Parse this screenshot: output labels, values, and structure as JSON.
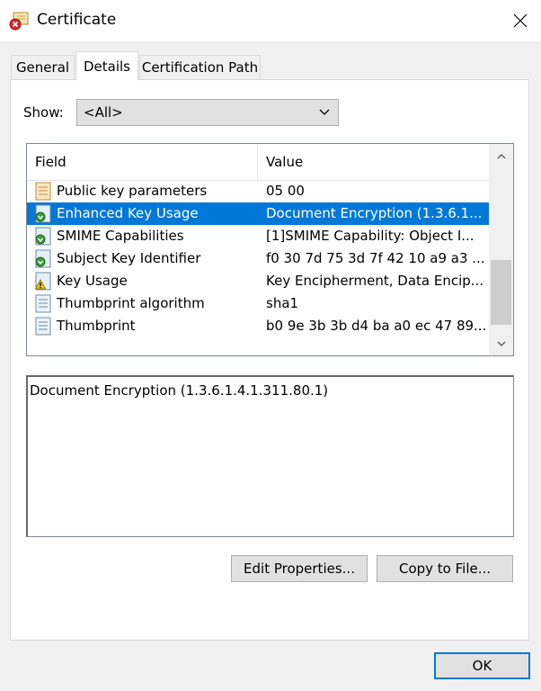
{
  "window": {
    "title": "Certificate",
    "title_icon": "certificate-error-icon",
    "close_icon": "close-icon"
  },
  "tabs": [
    {
      "label": "General"
    },
    {
      "label": "Details",
      "active": true
    },
    {
      "label": "Certification Path"
    }
  ],
  "show": {
    "label": "Show:",
    "selected": "<All>"
  },
  "list": {
    "headers": {
      "field": "Field",
      "value": "Value"
    },
    "rows": [
      {
        "field": "Public key parameters",
        "value": "05 00",
        "icon": "document-icon"
      },
      {
        "field": "Enhanced Key Usage",
        "value": "Document Encryption (1.3.6.1...",
        "icon": "extension-icon",
        "selected": true
      },
      {
        "field": "SMIME Capabilities",
        "value": "[1]SMIME Capability: Object I...",
        "icon": "extension-icon"
      },
      {
        "field": "Subject Key Identifier",
        "value": "f0 30 7d 75 3d 7f 42 10 a9 a3 ...",
        "icon": "extension-icon"
      },
      {
        "field": "Key Usage",
        "value": "Key Encipherment, Data Encip...",
        "icon": "warning-icon"
      },
      {
        "field": "Thumbprint algorithm",
        "value": "sha1",
        "icon": "document-icon"
      },
      {
        "field": "Thumbprint",
        "value": "b0 9e 3b 3b d4 ba a0 ec 47 89...",
        "icon": "document-icon"
      }
    ]
  },
  "detail": {
    "text": "Document Encryption (1.3.6.1.4.1.311.80.1)"
  },
  "buttons": {
    "edit_properties": "Edit Properties...",
    "copy_to_file": "Copy to File...",
    "ok": "OK"
  },
  "colors": {
    "selection": "#0078d7",
    "window_bg": "#f0f0f0"
  }
}
